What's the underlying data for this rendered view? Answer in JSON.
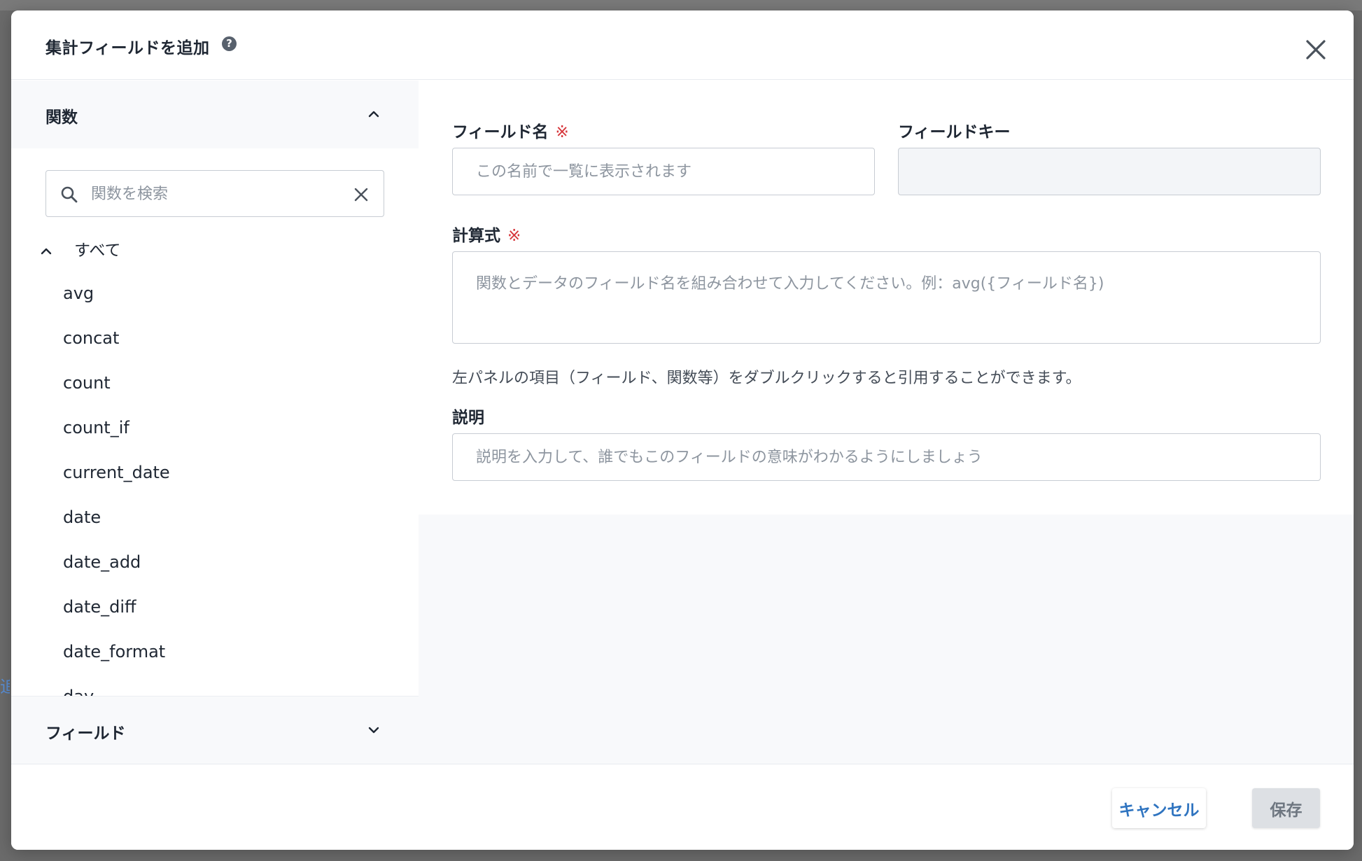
{
  "background": {
    "link_fragment": "追"
  },
  "dialog": {
    "title": "集計フィールドを追加",
    "help_icon": "?",
    "close_icon": "close-icon"
  },
  "left_panel": {
    "functions_section": {
      "label": "関数",
      "expanded": true,
      "search": {
        "placeholder": "関数を検索",
        "value": ""
      },
      "group": {
        "label": "すべて",
        "expanded": true,
        "items": [
          "avg",
          "concat",
          "count",
          "count_if",
          "current_date",
          "date",
          "date_add",
          "date_diff",
          "date_format",
          "day"
        ]
      }
    },
    "fields_section": {
      "label": "フィールド",
      "expanded": false
    }
  },
  "form": {
    "field_name": {
      "label": "フィールド名",
      "required_mark": "※",
      "placeholder": "この名前で一覧に表示されます",
      "value": ""
    },
    "field_key": {
      "label": "フィールドキー",
      "value": ""
    },
    "formula": {
      "label": "計算式",
      "required_mark": "※",
      "placeholder": "関数とデータのフィールド名を組み合わせて入力してください。例：avg({フィールド名})",
      "value": ""
    },
    "hint": "左パネルの項目（フィールド、関数等）をダブルクリックすると引用することができます。",
    "description": {
      "label": "説明",
      "placeholder": "説明を入力して、誰でもこのフィールドの意味がわかるようにしましょう",
      "value": ""
    }
  },
  "footer": {
    "cancel_label": "キャンセル",
    "save_label": "保存"
  },
  "colors": {
    "accent": "#2f74c0",
    "required": "#d6363b",
    "panel_bg": "#f8f9fb",
    "disabled_button": "#dde0e4"
  }
}
